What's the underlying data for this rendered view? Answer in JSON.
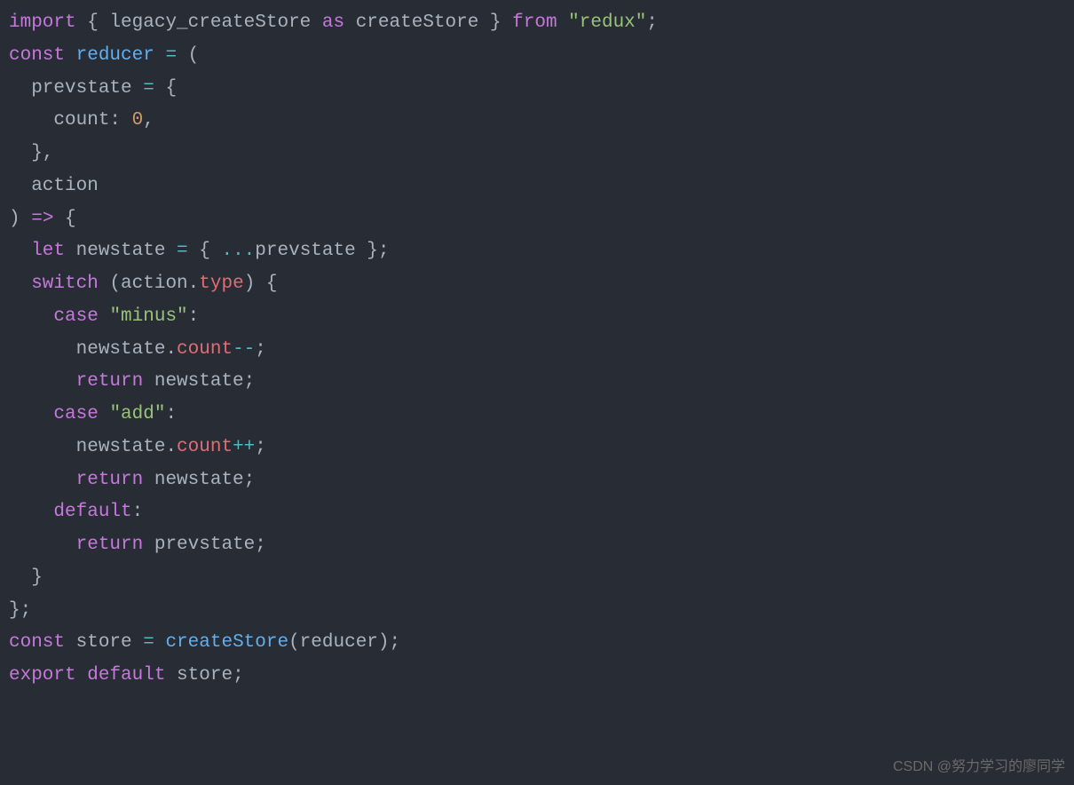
{
  "code": {
    "l1_import": "import",
    "l1_brace_open": " { ",
    "l1_legacy": "legacy_createStore",
    "l1_as": " as ",
    "l1_create": "createStore",
    "l1_brace_close": " } ",
    "l1_from": "from",
    "l1_sp": " ",
    "l1_str": "\"redux\"",
    "l1_semi": ";",
    "l2_const": "const",
    "l2_sp": " ",
    "l2_reducer": "reducer",
    "l2_eq": " = ",
    "l2_paren": "(",
    "l3_prev": "  prevstate",
    "l3_eq": " = ",
    "l3_brace": "{",
    "l4_count": "    count",
    "l4_colon": ": ",
    "l4_zero": "0",
    "l4_comma": ",",
    "l5_close": "  },",
    "l6_action": "  action",
    "l7_close": ") ",
    "l7_arrow": "=>",
    "l7_brace": " {",
    "l8_let": "  let",
    "l8_new": " newstate ",
    "l8_eq": "=",
    "l8_open": " { ",
    "l8_spread": "...",
    "l8_prev": "prevstate",
    "l8_close": " };",
    "l9_switch": "  switch",
    "l9_paren": " (action",
    "l9_dot": ".",
    "l9_type": "type",
    "l9_close": ") {",
    "l10_case": "    case",
    "l10_sp": " ",
    "l10_str": "\"minus\"",
    "l10_colon": ":",
    "l11_new": "      newstate",
    "l11_dot": ".",
    "l11_count": "count",
    "l11_op": "--",
    "l11_semi": ";",
    "l12_ret": "      return",
    "l12_new": " newstate;",
    "l13_case": "    case",
    "l13_sp": " ",
    "l13_str": "\"add\"",
    "l13_colon": ":",
    "l14_new": "      newstate",
    "l14_dot": ".",
    "l14_count": "count",
    "l14_op": "++",
    "l14_semi": ";",
    "l15_ret": "      return",
    "l15_new": " newstate;",
    "l16_def": "    default",
    "l16_colon": ":",
    "l17_ret": "      return",
    "l17_prev": " prevstate;",
    "l18_close": "  }",
    "l19_close": "};",
    "l20_const": "const",
    "l20_store": " store ",
    "l20_eq": "=",
    "l20_sp": " ",
    "l20_func": "createStore",
    "l20_args": "(reducer);",
    "l21_export": "export",
    "l21_sp": " ",
    "l21_default": "default",
    "l21_store": " store;"
  },
  "watermark": "CSDN @努力学习的廖同学"
}
